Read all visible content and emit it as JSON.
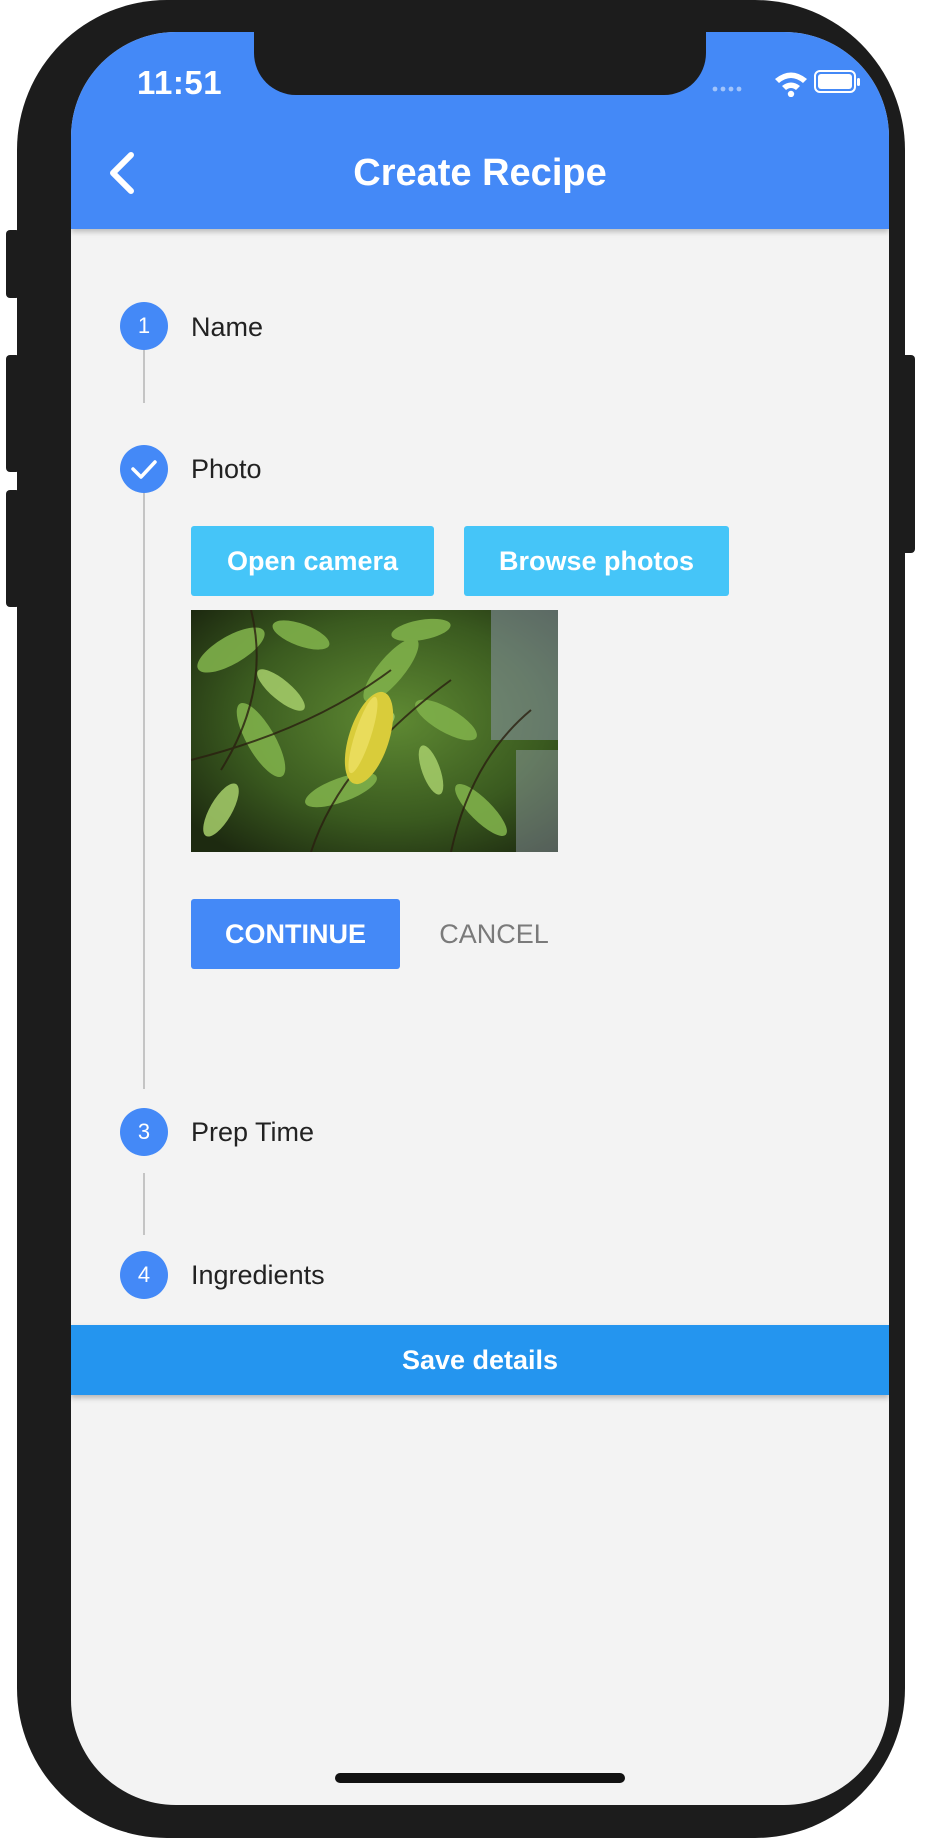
{
  "status_bar": {
    "time": "11:51"
  },
  "app_bar": {
    "title": "Create Recipe",
    "back_icon": "chevron-left-icon"
  },
  "stepper": {
    "steps": [
      {
        "indicator": "1",
        "label": "Name",
        "state": "pending"
      },
      {
        "indicator": "check",
        "label": "Photo",
        "state": "active"
      },
      {
        "indicator": "3",
        "label": "Prep Time",
        "state": "pending"
      },
      {
        "indicator": "4",
        "label": "Ingredients",
        "state": "pending"
      }
    ],
    "photo_step": {
      "open_camera_label": "Open camera",
      "browse_photos_label": "Browse photos",
      "continue_label": "CONTINUE",
      "cancel_label": "CANCEL"
    }
  },
  "save_button_label": "Save details",
  "colors": {
    "primary": "#4489f7",
    "accent_cyan": "#45c5f8",
    "save_bar": "#2495ef",
    "background": "#f3f3f3",
    "frame": "#1c1c1c"
  }
}
